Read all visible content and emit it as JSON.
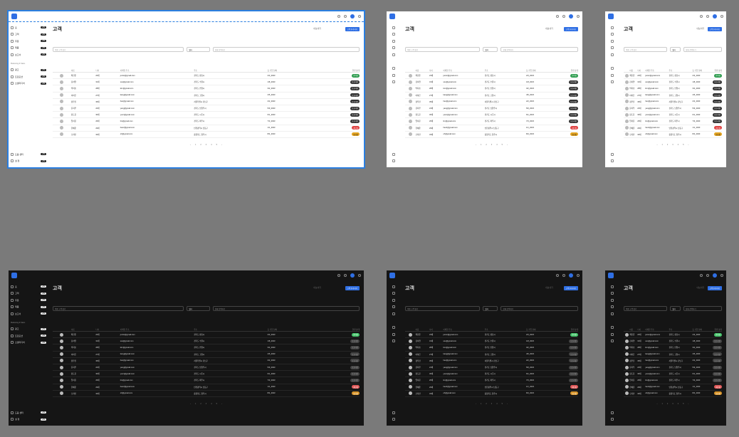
{
  "app": {
    "page_title": "고객",
    "export_label": "내보내기",
    "add_label": "고객 추가하기",
    "search_placeholder": "이름 고객 찾기",
    "filter_label": "필터",
    "status_placeholder": "상태 선택하기",
    "pager": [
      "‹",
      "1",
      "2",
      "3",
      "4",
      "5",
      "›"
    ]
  },
  "sidebar": {
    "items": [
      {
        "label": "홈",
        "badge": "+99"
      },
      {
        "label": "고객",
        "badge": "+99"
      },
      {
        "label": "주문",
        "badge": "+99"
      },
      {
        "label": "제품",
        "badge": "+99"
      },
      {
        "label": "보고서",
        "badge": "+99"
      }
    ],
    "section_label": "Marketing & Sales",
    "section_items": [
      {
        "label": "광고",
        "badge": "+99"
      },
      {
        "label": "프로모션",
        "badge": "+99"
      },
      {
        "label": "소셜미디어",
        "badge": "+99"
      }
    ],
    "bottom_items": [
      {
        "label": "도움 센터",
        "badge": "+99"
      },
      {
        "label": "설 정",
        "badge": "+99"
      }
    ]
  },
  "table": {
    "headers": [
      "",
      "이름",
      "나이",
      "이메일 주소",
      "주소",
      "등 가입 날짜",
      "연결 상태"
    ],
    "rows": [
      {
        "name": "최민준",
        "age": "23세",
        "email": "junior@gmail.com",
        "addr": "경기도 성남시",
        "date": "2/3_2023",
        "status": "온라인",
        "kind": "ok"
      },
      {
        "name": "김서연",
        "age": "31세",
        "email": "soo@gmail.com",
        "addr": "경기도 수원시",
        "date": "1/8_2023",
        "status": "오프라인",
        "kind": "off"
      },
      {
        "name": "박지호",
        "age": "28세",
        "email": "kim@gmail.com",
        "addr": "경기도 안양시",
        "date": "3/2_2023",
        "status": "오프라인",
        "kind": "off"
      },
      {
        "name": "이하은",
        "age": "27세",
        "email": "kang@gmail.com",
        "addr": "경기도 고양시",
        "date": "4/5_2023",
        "status": "오프라인",
        "kind": "off"
      },
      {
        "name": "정우진",
        "age": "35세",
        "email": "han@gmail.com",
        "addr": "서울특별시 강남구",
        "date": "2/2_2023",
        "status": "오프라인",
        "kind": "off"
      },
      {
        "name": "윤지우",
        "age": "24세",
        "email": "yang@gmail.com",
        "addr": "경기도 남양주시",
        "date": "5/9_2023",
        "status": "오프라인",
        "kind": "off"
      },
      {
        "name": "장도윤",
        "age": "30세",
        "email": "yoon@gmail.com",
        "addr": "경기도 시흥시",
        "date": "6/1_2023",
        "status": "오프라인",
        "kind": "off"
      },
      {
        "name": "임서윤",
        "age": "26세",
        "email": "lim@gmail.com",
        "addr": "경기도 파주시",
        "date": "7/3_2023",
        "status": "오프라인",
        "kind": "off"
      },
      {
        "name": "한예준",
        "age": "29세",
        "email": "han2@gmail.com",
        "addr": "인천광역시 남동구",
        "date": "1/1_2023",
        "status": "차단됨",
        "kind": "bad"
      },
      {
        "name": "오지안",
        "age": "33세",
        "email": "oh@gmail.com",
        "addr": "충청북도 청주시",
        "date": "8/4_2023",
        "status": "대기중",
        "kind": "warn"
      }
    ]
  }
}
